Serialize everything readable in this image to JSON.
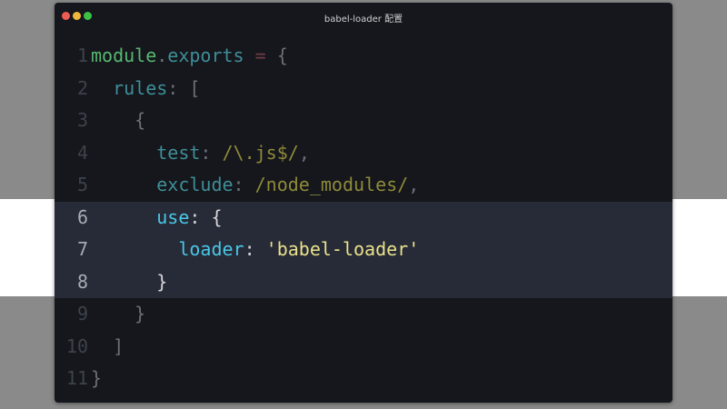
{
  "window": {
    "title": "babel-loader 配置"
  },
  "editor": {
    "lines": [
      {
        "num": "1",
        "tokens": [
          {
            "text": "module",
            "kind": "kw"
          },
          {
            "text": ".",
            "kind": "pn"
          },
          {
            "text": "exports",
            "kind": "prop"
          },
          {
            "text": " = ",
            "kind": "op"
          },
          {
            "text": "{",
            "kind": "pn"
          }
        ]
      },
      {
        "num": "2",
        "tokens": [
          {
            "text": "  rules",
            "kind": "prop"
          },
          {
            "text": ": [",
            "kind": "pn"
          }
        ]
      },
      {
        "num": "3",
        "tokens": [
          {
            "text": "    {",
            "kind": "pn"
          }
        ]
      },
      {
        "num": "4",
        "tokens": [
          {
            "text": "      test",
            "kind": "prop"
          },
          {
            "text": ": ",
            "kind": "pn"
          },
          {
            "text": "/\\.js$/",
            "kind": "regex"
          },
          {
            "text": ",",
            "kind": "pn"
          }
        ]
      },
      {
        "num": "5",
        "tokens": [
          {
            "text": "      exclude",
            "kind": "prop"
          },
          {
            "text": ": ",
            "kind": "pn"
          },
          {
            "text": "/node_modules/",
            "kind": "regex"
          },
          {
            "text": ",",
            "kind": "pn"
          }
        ]
      },
      {
        "num": "6",
        "highlighted": true,
        "tokens": [
          {
            "text": "      use",
            "kind": "prop"
          },
          {
            "text": ": {",
            "kind": "pn"
          }
        ]
      },
      {
        "num": "7",
        "highlighted": true,
        "tokens": [
          {
            "text": "        loader",
            "kind": "prop"
          },
          {
            "text": ": ",
            "kind": "pn"
          },
          {
            "text": "'babel-loader'",
            "kind": "str"
          }
        ]
      },
      {
        "num": "8",
        "highlighted": true,
        "tokens": [
          {
            "text": "      }",
            "kind": "pn"
          }
        ]
      },
      {
        "num": "9",
        "tokens": [
          {
            "text": "    }",
            "kind": "pn"
          }
        ]
      },
      {
        "num": "10",
        "tokens": [
          {
            "text": "  ]",
            "kind": "pn"
          }
        ]
      },
      {
        "num": "11",
        "tokens": [
          {
            "text": "}",
            "kind": "pn"
          }
        ]
      }
    ]
  },
  "colors": {
    "background": "#8a8a8a",
    "window_bg": "#15171c",
    "highlight_bg": "#272a37",
    "close": "#ee5b52",
    "minimize": "#f0b83a",
    "maximize": "#3cc146"
  }
}
